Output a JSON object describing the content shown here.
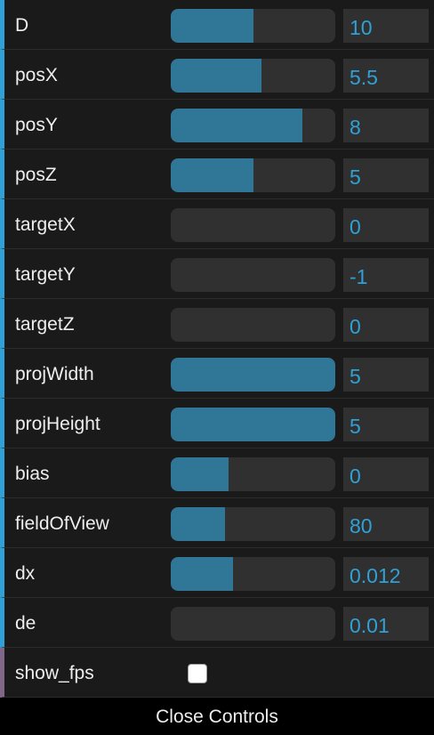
{
  "controls": [
    {
      "label": "D",
      "value": "10",
      "fill_pct": 50
    },
    {
      "label": "posX",
      "value": "5.5",
      "fill_pct": 55
    },
    {
      "label": "posY",
      "value": "8",
      "fill_pct": 80
    },
    {
      "label": "posZ",
      "value": "5",
      "fill_pct": 50
    },
    {
      "label": "targetX",
      "value": "0",
      "fill_pct": 0
    },
    {
      "label": "targetY",
      "value": "-1",
      "fill_pct": 0
    },
    {
      "label": "targetZ",
      "value": "0",
      "fill_pct": 0
    },
    {
      "label": "projWidth",
      "value": "5",
      "fill_pct": 100
    },
    {
      "label": "projHeight",
      "value": "5",
      "fill_pct": 100
    },
    {
      "label": "bias",
      "value": "0",
      "fill_pct": 35
    },
    {
      "label": "fieldOfView",
      "value": "80",
      "fill_pct": 33
    },
    {
      "label": "dx",
      "value": "0.012",
      "fill_pct": 38
    },
    {
      "label": "de",
      "value": "0.01",
      "fill_pct": 0
    }
  ],
  "toggle": {
    "label": "show_fps",
    "checked": false
  },
  "close_label": "Close Controls",
  "colors": {
    "accent": "#2fa1d6",
    "boolean_accent": "#806787"
  }
}
